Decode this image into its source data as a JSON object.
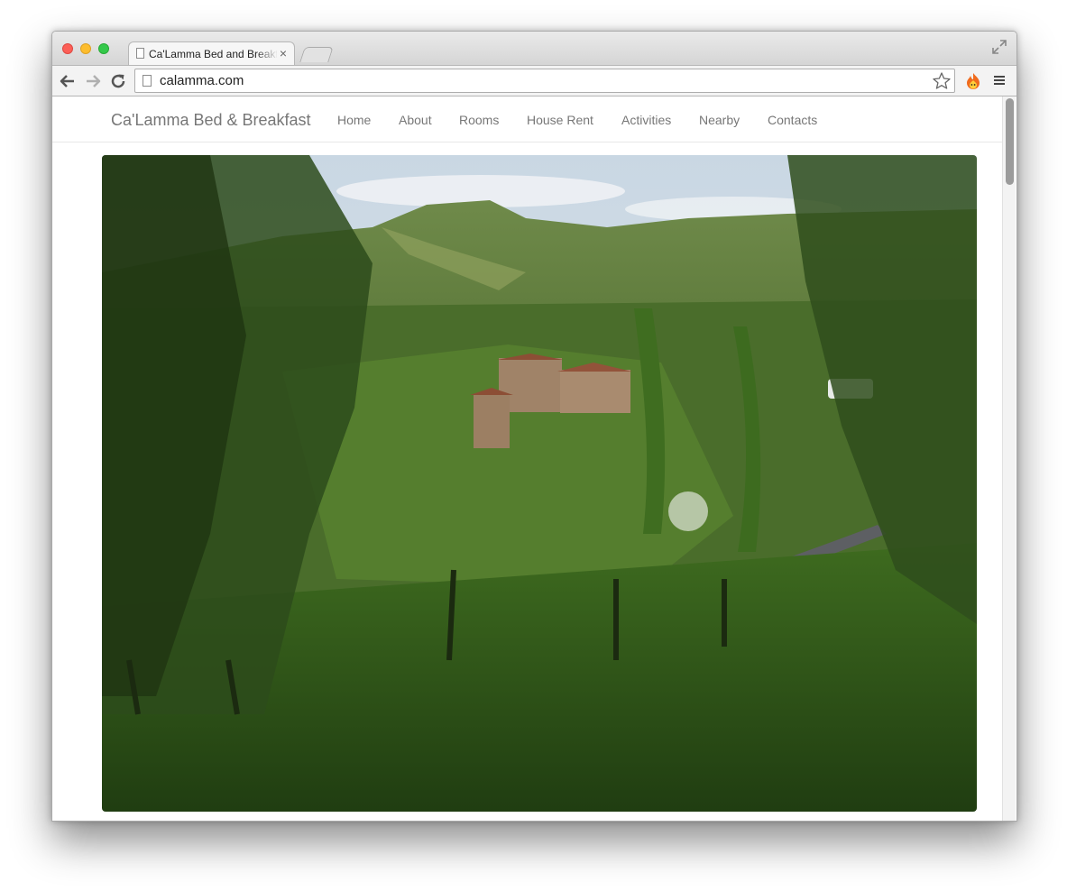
{
  "browser": {
    "tab_title": "Ca'Lamma Bed and Breakfast",
    "tab_close": "×",
    "url": "calamma.com"
  },
  "site": {
    "brand": "Ca'Lamma Bed & Breakfast",
    "nav": [
      "Home",
      "About",
      "Rooms",
      "House Rent",
      "Activities",
      "Nearby",
      "Contacts"
    ]
  },
  "colors": {
    "nav_text": "#777777",
    "chrome_bg": "#f3f3f3",
    "scrollbar_thumb": "#9b9b9b"
  },
  "hero_image": {
    "icon": "landscape-photo"
  }
}
